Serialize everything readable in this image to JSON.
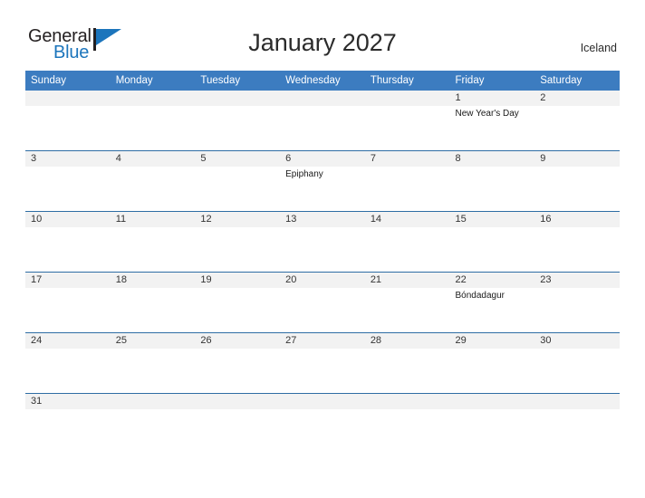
{
  "brand": {
    "word_one": "General",
    "word_two": "Blue",
    "flag_color": "#1c75bc",
    "text_color": "#231f20"
  },
  "header": {
    "title": "January 2027",
    "locale": "Iceland"
  },
  "calendar": {
    "accent_color": "#3c7cc0",
    "row_border_color": "#2e6da4",
    "daynum_band_color": "#f2f2f2",
    "weekday_headers": [
      "Sunday",
      "Monday",
      "Tuesday",
      "Wednesday",
      "Thursday",
      "Friday",
      "Saturday"
    ],
    "weeks": [
      [
        {
          "day": "",
          "events": []
        },
        {
          "day": "",
          "events": []
        },
        {
          "day": "",
          "events": []
        },
        {
          "day": "",
          "events": []
        },
        {
          "day": "",
          "events": []
        },
        {
          "day": "1",
          "events": [
            "New Year's Day"
          ]
        },
        {
          "day": "2",
          "events": []
        }
      ],
      [
        {
          "day": "3",
          "events": []
        },
        {
          "day": "4",
          "events": []
        },
        {
          "day": "5",
          "events": []
        },
        {
          "day": "6",
          "events": [
            "Epiphany"
          ]
        },
        {
          "day": "7",
          "events": []
        },
        {
          "day": "8",
          "events": []
        },
        {
          "day": "9",
          "events": []
        }
      ],
      [
        {
          "day": "10",
          "events": []
        },
        {
          "day": "11",
          "events": []
        },
        {
          "day": "12",
          "events": []
        },
        {
          "day": "13",
          "events": []
        },
        {
          "day": "14",
          "events": []
        },
        {
          "day": "15",
          "events": []
        },
        {
          "day": "16",
          "events": []
        }
      ],
      [
        {
          "day": "17",
          "events": []
        },
        {
          "day": "18",
          "events": []
        },
        {
          "day": "19",
          "events": []
        },
        {
          "day": "20",
          "events": []
        },
        {
          "day": "21",
          "events": []
        },
        {
          "day": "22",
          "events": [
            "Bóndadagur"
          ]
        },
        {
          "day": "23",
          "events": []
        }
      ],
      [
        {
          "day": "24",
          "events": []
        },
        {
          "day": "25",
          "events": []
        },
        {
          "day": "26",
          "events": []
        },
        {
          "day": "27",
          "events": []
        },
        {
          "day": "28",
          "events": []
        },
        {
          "day": "29",
          "events": []
        },
        {
          "day": "30",
          "events": []
        }
      ],
      [
        {
          "day": "31",
          "events": []
        },
        {
          "day": "",
          "events": []
        },
        {
          "day": "",
          "events": []
        },
        {
          "day": "",
          "events": []
        },
        {
          "day": "",
          "events": []
        },
        {
          "day": "",
          "events": []
        },
        {
          "day": "",
          "events": []
        }
      ]
    ]
  }
}
